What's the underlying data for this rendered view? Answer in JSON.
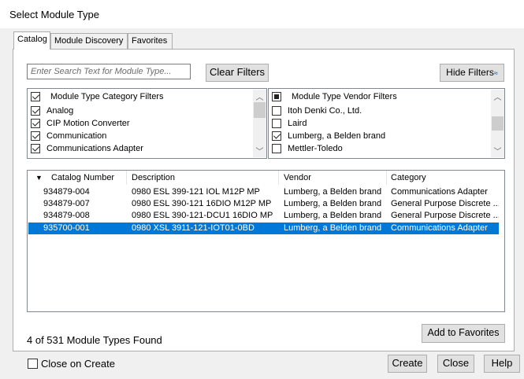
{
  "window": {
    "title": "Select Module Type"
  },
  "tabs": [
    {
      "label": "Catalog"
    },
    {
      "label": "Module Discovery"
    },
    {
      "label": "Favorites"
    }
  ],
  "search": {
    "placeholder": "Enter Search Text for Module Type..."
  },
  "buttons": {
    "clear_filters": "Clear Filters",
    "hide_filters": "Hide Filters",
    "add_to_favorites": "Add to Favorites",
    "create": "Create",
    "close": "Close",
    "help": "Help"
  },
  "category_filters": {
    "header": "Module Type Category Filters",
    "header_checked": true,
    "items": [
      {
        "label": "Analog",
        "checked": true
      },
      {
        "label": "CIP Motion Converter",
        "checked": true
      },
      {
        "label": "Communication",
        "checked": true
      },
      {
        "label": "Communications Adapter",
        "checked": true
      }
    ]
  },
  "vendor_filters": {
    "header": "Module Type Vendor Filters",
    "header_state": "partial",
    "items": [
      {
        "label": "Itoh Denki Co., Ltd.",
        "checked": false
      },
      {
        "label": "Laird",
        "checked": false
      },
      {
        "label": "Lumberg, a Belden brand",
        "checked": true
      },
      {
        "label": "Mettler-Toledo",
        "checked": false
      }
    ]
  },
  "results_table": {
    "sort_indicator": "▼",
    "columns": [
      "Catalog Number",
      "Description",
      "Vendor",
      "Category"
    ],
    "rows": [
      {
        "catalog": "934879-004",
        "description": "0980 ESL 399-121 IOL M12P MP",
        "vendor": "Lumberg, a Belden brand",
        "category": "Communications Adapter",
        "selected": false
      },
      {
        "catalog": "934879-007",
        "description": "0980 ESL 390-121 16DIO M12P MP",
        "vendor": "Lumberg, a Belden brand",
        "category": "General Purpose Discrete ...",
        "selected": false
      },
      {
        "catalog": "934879-008",
        "description": "0980 ESL 390-121-DCU1 16DIO MP",
        "vendor": "Lumberg, a Belden brand",
        "category": "General Purpose Discrete ...",
        "selected": false
      },
      {
        "catalog": "935700-001",
        "description": "0980 XSL 3911-121-IOT01-0BD",
        "vendor": "Lumberg, a Belden brand",
        "category": "Communications Adapter",
        "selected": true
      }
    ]
  },
  "status": {
    "found_text": "4 of 531 Module Types Found"
  },
  "footer": {
    "close_on_create_label": "Close on Create",
    "close_on_create_checked": false
  },
  "colors": {
    "selection": "#0078d7",
    "panel": "#ffffff",
    "chrome": "#f0f0f0"
  }
}
